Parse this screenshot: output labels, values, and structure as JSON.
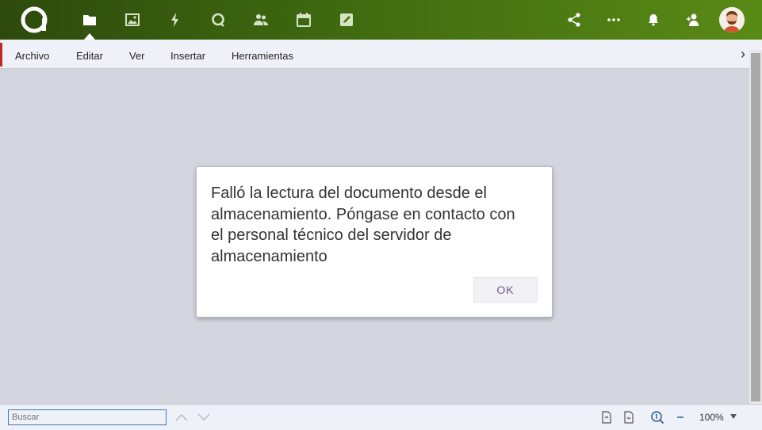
{
  "topbar": {
    "icons": [
      "app-logo",
      "files-icon",
      "photos-icon",
      "activity-icon",
      "talk-icon",
      "contacts-icon",
      "calendar-icon",
      "notes-icon",
      "share-icon",
      "more-icon",
      "notifications-icon",
      "add-contact-icon",
      "user-avatar"
    ],
    "gradient_colors": [
      "#2d4a0c",
      "#5a8a16"
    ]
  },
  "menubar": {
    "items": [
      "Archivo",
      "Editar",
      "Ver",
      "Insertar",
      "Herramientas"
    ],
    "accent_color": "#c0272d"
  },
  "dialog": {
    "lines": [
      "Falló la lectura del documento desde el",
      "almacenamiento. Póngase en contacto con",
      "el personal técnico del servidor de",
      "almacenamiento"
    ],
    "ok_label": "OK"
  },
  "statusbar": {
    "search_placeholder": "Buscar",
    "zoom": "100%"
  }
}
